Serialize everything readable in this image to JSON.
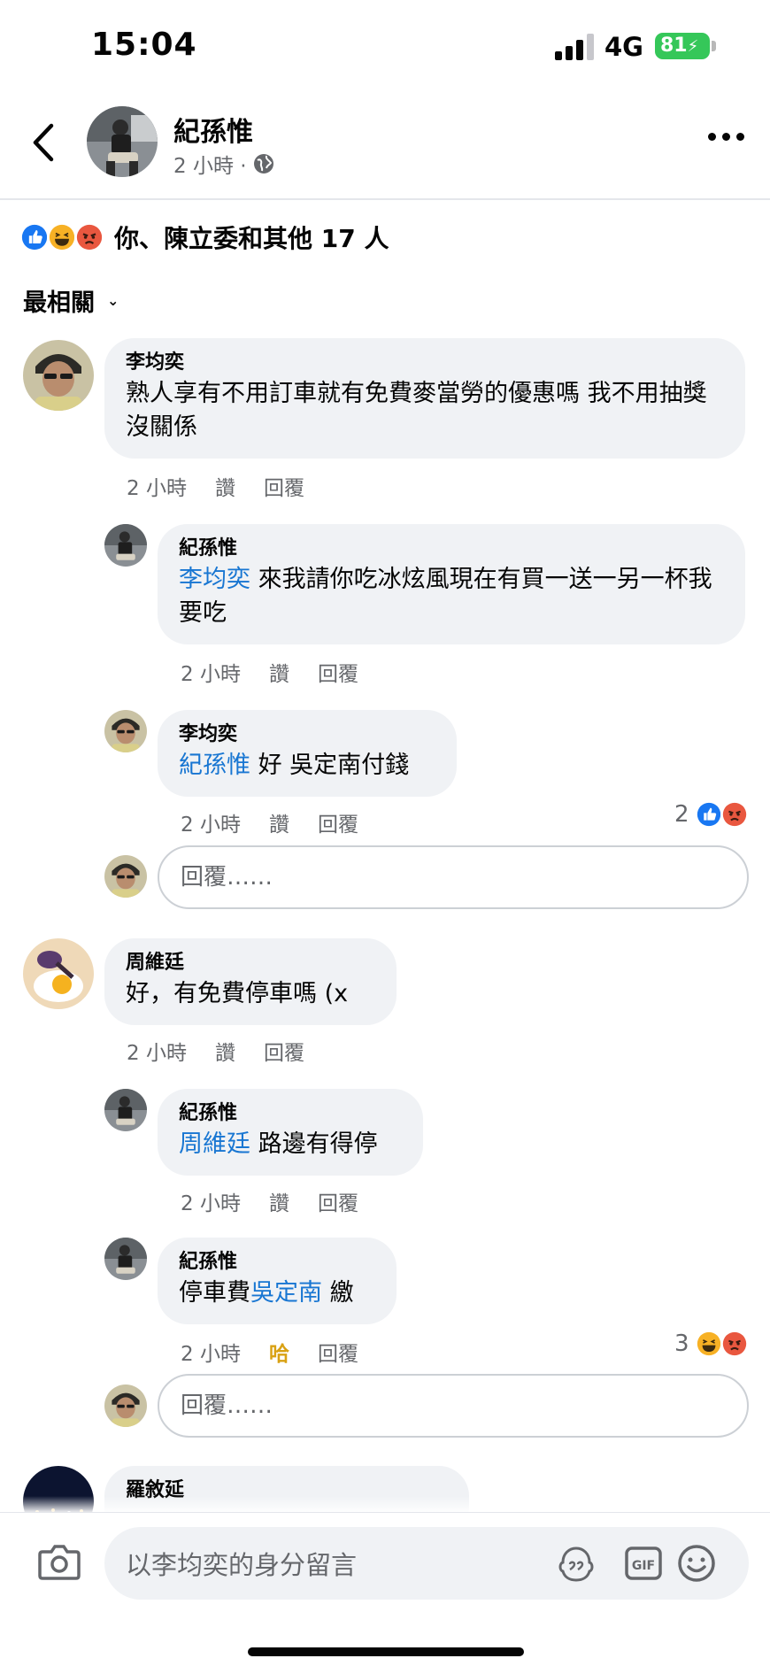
{
  "status_bar": {
    "time": "15:04",
    "network": "4G",
    "battery": "81"
  },
  "header": {
    "name": "紀孫惟",
    "time": "2 小時 ·"
  },
  "reactions": {
    "summary": "你、陳立委和其他 17 人"
  },
  "sort": {
    "label": "最相關"
  },
  "actions": {
    "like": "讚",
    "reply": "回覆",
    "haha": "哈"
  },
  "reply_placeholder": "回覆……",
  "comments": [
    {
      "author": "李均奕",
      "text": "熟人享有不用訂車就有免費麥當勞的優惠嗎 我不用抽獎沒關係",
      "time": "2 小時"
    },
    {
      "author": "紀孫惟",
      "mention": "李均奕",
      "text": " 來我請你吃冰炫風現在有買一送一另一杯我要吃",
      "time": "2 小時"
    },
    {
      "author": "李均奕",
      "mention": "紀孫惟",
      "text": " 好 吳定南付錢",
      "time": "2 小時",
      "reaction_count": "2"
    },
    {
      "author": "周維廷",
      "text": "好，有免費停車嗎 (x",
      "time": "2 小時"
    },
    {
      "author": "紀孫惟",
      "mention": "周維廷",
      "text": " 路邊有得停",
      "time": "2 小時"
    },
    {
      "author": "紀孫惟",
      "text_before": "停車費",
      "mention": "吳定南",
      "text_after": " 繳",
      "time": "2 小時",
      "reaction_count": "3"
    },
    {
      "author": "羅敘延"
    }
  ],
  "composer": {
    "placeholder": "以李均奕的身分留言"
  },
  "colors": {
    "accent": "#1876d2",
    "bubble": "#f0f2f5",
    "like": "#1877f2",
    "angry": "#e9573f",
    "haha": "#f7b125"
  },
  "icons": [
    "back-icon",
    "globe-icon",
    "more-icon",
    "like-icon",
    "haha-icon",
    "angry-icon",
    "chevron-down-icon",
    "camera-icon",
    "avatar-sticker-icon",
    "gif-icon",
    "emoji-icon"
  ]
}
